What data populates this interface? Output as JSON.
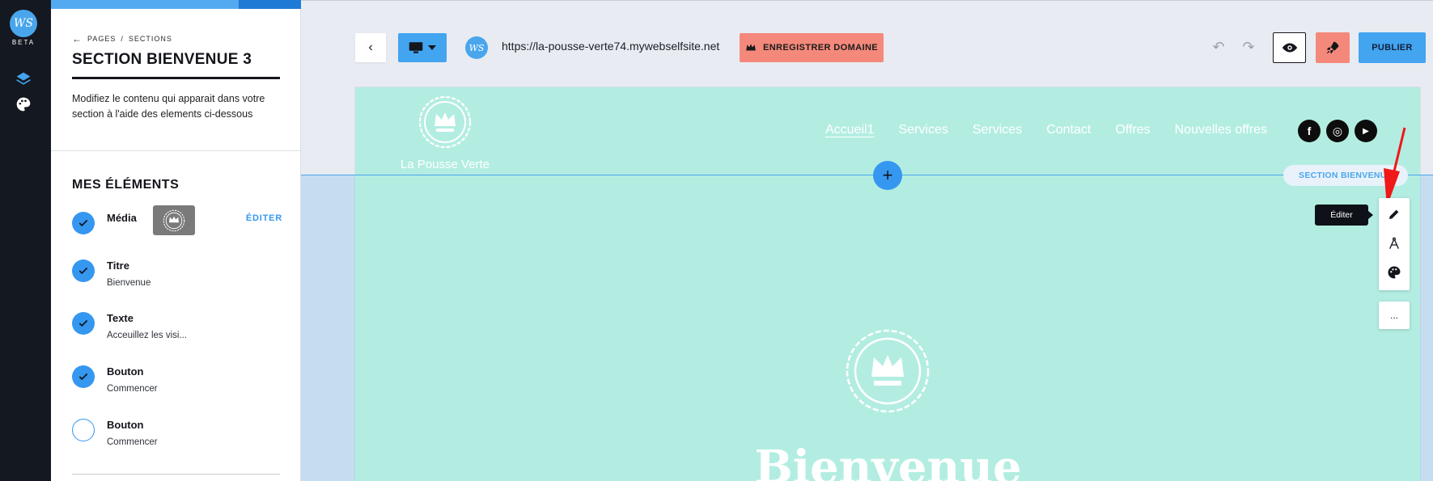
{
  "app": {
    "logo": "WS",
    "badge": "BETA"
  },
  "rail": {
    "items": [
      {
        "icon": "layers-icon"
      },
      {
        "icon": "palette-icon"
      }
    ]
  },
  "sidebar": {
    "progress_fraction": 0.75,
    "breadcrumb": {
      "back": "←",
      "pages": "PAGES",
      "sep": "/",
      "sections": "SECTIONS"
    },
    "title": "SECTION BIENVENUE 3",
    "description": "Modifiez le contenu qui apparait dans votre section à l'aide des elements ci-dessous",
    "elements_heading": "MES ÉLÉMENTS",
    "elements": [
      {
        "name": "Média",
        "sub": "",
        "checked": true,
        "edit": "ÉDITER"
      },
      {
        "name": "Titre",
        "sub": "Bienvenue",
        "checked": true
      },
      {
        "name": "Texte",
        "sub": "Acceuillez les visi...",
        "checked": true
      },
      {
        "name": "Bouton",
        "sub": "Commencer",
        "checked": true
      },
      {
        "name": "Bouton",
        "sub": "Commencer",
        "checked": false
      }
    ]
  },
  "toolbar": {
    "back": "‹",
    "site_logo": "WS",
    "url": "https://la-pousse-verte74.mywebselfsite.net",
    "domain_button": "ENREGISTRER DOMAINE",
    "undo": "↶",
    "redo": "↷",
    "publish": "PUBLIER",
    "colors": {
      "accent": "#43a4f0",
      "domain": "#f4897b"
    }
  },
  "site": {
    "brand": "La Pousse Verte",
    "nav": [
      "Accueil1",
      "Services",
      "Services",
      "Contact",
      "Offres",
      "Nouvelles offres"
    ],
    "socials": [
      {
        "icon": "facebook-icon",
        "glyph": "f"
      },
      {
        "icon": "instagram-icon",
        "glyph": "◎"
      },
      {
        "icon": "youtube-icon",
        "glyph": "▶"
      }
    ],
    "background": "#b3ede2",
    "section_pill": "SECTION BIENVENUE",
    "add": "+",
    "hero_title": "Bienvenue"
  },
  "tools": {
    "tooltip": "Éditer",
    "more": "..."
  }
}
